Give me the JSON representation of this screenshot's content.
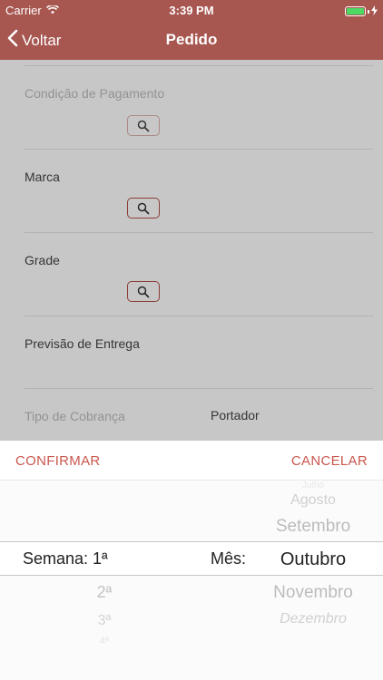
{
  "status": {
    "carrier": "Carrier",
    "time": "3:39 PM"
  },
  "nav": {
    "back_label": "Voltar",
    "title": "Pedido"
  },
  "form": {
    "fields": [
      {
        "label": "Condição de Pagamento"
      },
      {
        "label": "Marca"
      },
      {
        "label": "Grade"
      },
      {
        "label": "Previsão de Entrega"
      },
      {
        "label": "Tipo de Cobrança",
        "value": "Portador"
      }
    ]
  },
  "toolbar": {
    "confirm_label": "CONFIRMAR",
    "cancel_label": "CANCELAR"
  },
  "picker": {
    "week_label": "Semana: 1ª",
    "month_label": "Mês:",
    "week_options": [
      "2ª",
      "3ª",
      "4ª"
    ],
    "month_options_above": [
      "Julho",
      "Agosto",
      "Setembro"
    ],
    "month_selected": "Outubro",
    "month_options_below": [
      "Novembro",
      "Dezembro"
    ]
  },
  "colors": {
    "header": "#a75650",
    "accent": "#c9574e"
  }
}
